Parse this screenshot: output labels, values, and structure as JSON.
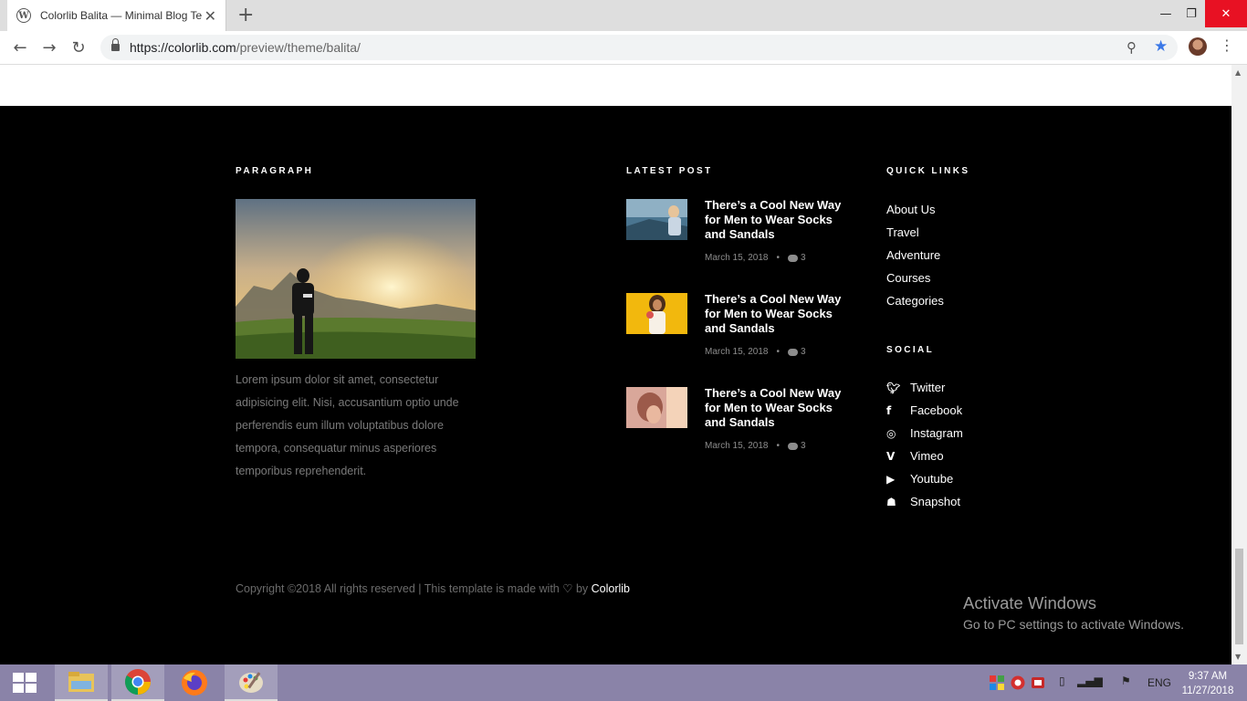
{
  "browser": {
    "tab_title": "Colorlib Balita — Minimal Blog Te",
    "tab_close": "✕",
    "new_tab": "+",
    "url_host": "https://colorlib.com",
    "url_path": "/preview/theme/balita/",
    "window_controls": {
      "minimize": "—",
      "restore": "❐",
      "close": "✕"
    }
  },
  "footer": {
    "paragraph": {
      "heading": "PARAGRAPH",
      "text": "Lorem ipsum dolor sit amet, consectetur adipisicing elit. Nisi, accusantium optio unde perferendis eum illum voluptatibus dolore tempora, consequatur minus asperiores temporibus reprehenderit."
    },
    "latest_post": {
      "heading": "LATEST POST",
      "posts": [
        {
          "title": "There’s a Cool New Way for Men to Wear Socks and Sandals",
          "date": "March 15, 2018",
          "comments": "3"
        },
        {
          "title": "There’s a Cool New Way for Men to Wear Socks and Sandals",
          "date": "March 15, 2018",
          "comments": "3"
        },
        {
          "title": "There’s a Cool New Way for Men to Wear Socks and Sandals",
          "date": "March 15, 2018",
          "comments": "3"
        }
      ],
      "meta_separator": "•"
    },
    "quick_links": {
      "heading": "QUICK LINKS",
      "items": [
        "About Us",
        "Travel",
        "Adventure",
        "Courses",
        "Categories"
      ]
    },
    "social": {
      "heading": "SOCIAL",
      "items": [
        {
          "label": "Twitter",
          "icon": "twitter-icon"
        },
        {
          "label": "Facebook",
          "icon": "facebook-icon"
        },
        {
          "label": "Instagram",
          "icon": "instagram-icon"
        },
        {
          "label": "Vimeo",
          "icon": "vimeo-icon"
        },
        {
          "label": "Youtube",
          "icon": "youtube-icon"
        },
        {
          "label": "Snapshot",
          "icon": "snapchat-icon"
        }
      ]
    },
    "copyright": {
      "prefix": "Copyright ©2018 All rights reserved | This template is made with",
      "heart": "♡",
      "by": "by",
      "brand": "Colorlib"
    }
  },
  "windows_watermark": {
    "line1": "Activate Windows",
    "line2": "Go to PC settings to activate Windows."
  },
  "taskbar": {
    "lang": "ENG",
    "time": "9:37 AM",
    "date": "11/27/2018"
  },
  "colors": {
    "footer_bg": "#000000",
    "accent_star": "#3b78e7",
    "taskbar": "#8a83a8"
  }
}
